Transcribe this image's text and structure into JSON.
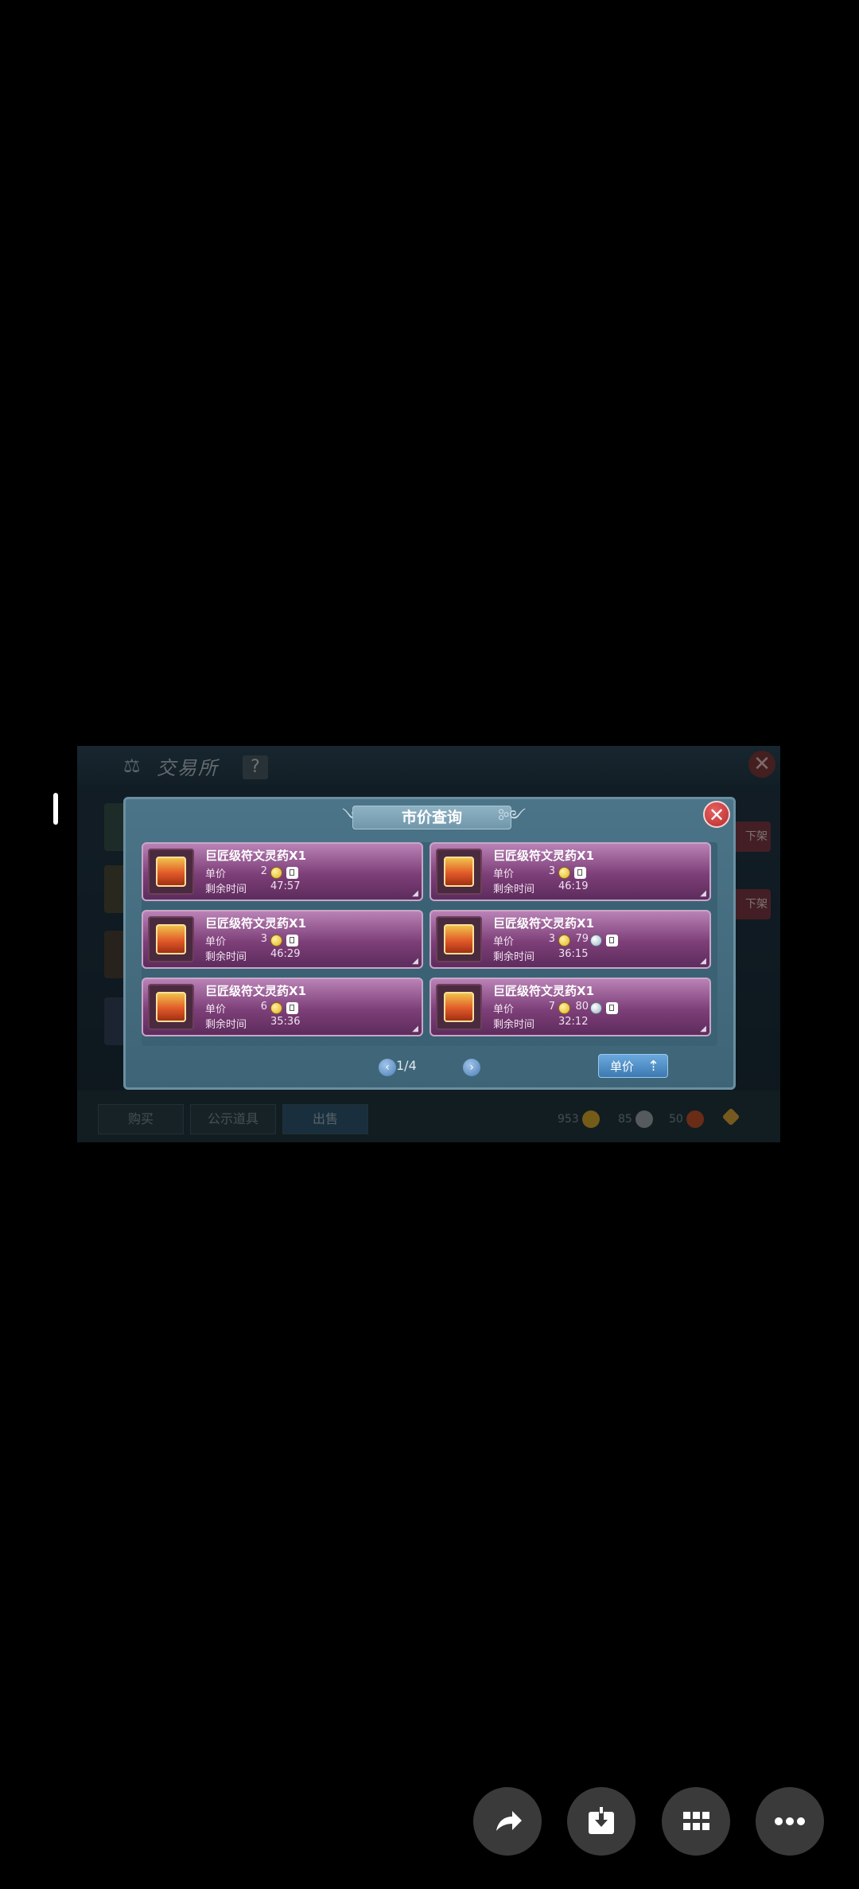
{
  "game": {
    "title": "交易所",
    "help_label": "?",
    "close_label": "✕",
    "side_buttons": [
      "下架",
      "下架"
    ],
    "tabs": [
      {
        "label": "购买",
        "active": false
      },
      {
        "label": "公示道具",
        "active": false
      },
      {
        "label": "出售",
        "active": true
      }
    ],
    "currencies": [
      {
        "amount": "953",
        "icon": "gold-coin-icon",
        "color": "#d4a72c"
      },
      {
        "amount": "85",
        "icon": "silver-coin-icon",
        "color": "#9aa4ab"
      },
      {
        "amount": "50",
        "icon": "red-token-icon",
        "color": "#c0502a"
      },
      {
        "amount": "",
        "icon": "diamond-icon",
        "color": "#d8a23a"
      }
    ]
  },
  "modal": {
    "title": "市价查询",
    "close_label": "✕",
    "listings": [
      {
        "name": "巨匠级符文灵药X1",
        "price_label": "单价",
        "gold": "2",
        "silver": "",
        "time_label": "剩余时间",
        "time": "47:57"
      },
      {
        "name": "巨匠级符文灵药X1",
        "price_label": "单价",
        "gold": "3",
        "silver": "",
        "time_label": "剩余时间",
        "time": "46:19"
      },
      {
        "name": "巨匠级符文灵药X1",
        "price_label": "单价",
        "gold": "3",
        "silver": "",
        "time_label": "剩余时间",
        "time": "46:29"
      },
      {
        "name": "巨匠级符文灵药X1",
        "price_label": "单价",
        "gold": "3",
        "silver": "79",
        "time_label": "剩余时间",
        "time": "36:15"
      },
      {
        "name": "巨匠级符文灵药X1",
        "price_label": "单价",
        "gold": "6",
        "silver": "",
        "time_label": "剩余时间",
        "time": "35:36"
      },
      {
        "name": "巨匠级符文灵药X1",
        "price_label": "单价",
        "gold": "7",
        "silver": "80",
        "time_label": "剩余时间",
        "time": "32:12"
      }
    ],
    "pagination": {
      "text": "1/4",
      "prev": "‹",
      "next": "›"
    },
    "sort_button": {
      "label": "单价",
      "arrow": "⇡"
    }
  },
  "actions": [
    {
      "name": "share-button",
      "icon": "share-icon"
    },
    {
      "name": "download-button",
      "icon": "download-icon"
    },
    {
      "name": "apps-button",
      "icon": "grid-icon"
    },
    {
      "name": "more-button",
      "icon": "more-icon"
    }
  ]
}
